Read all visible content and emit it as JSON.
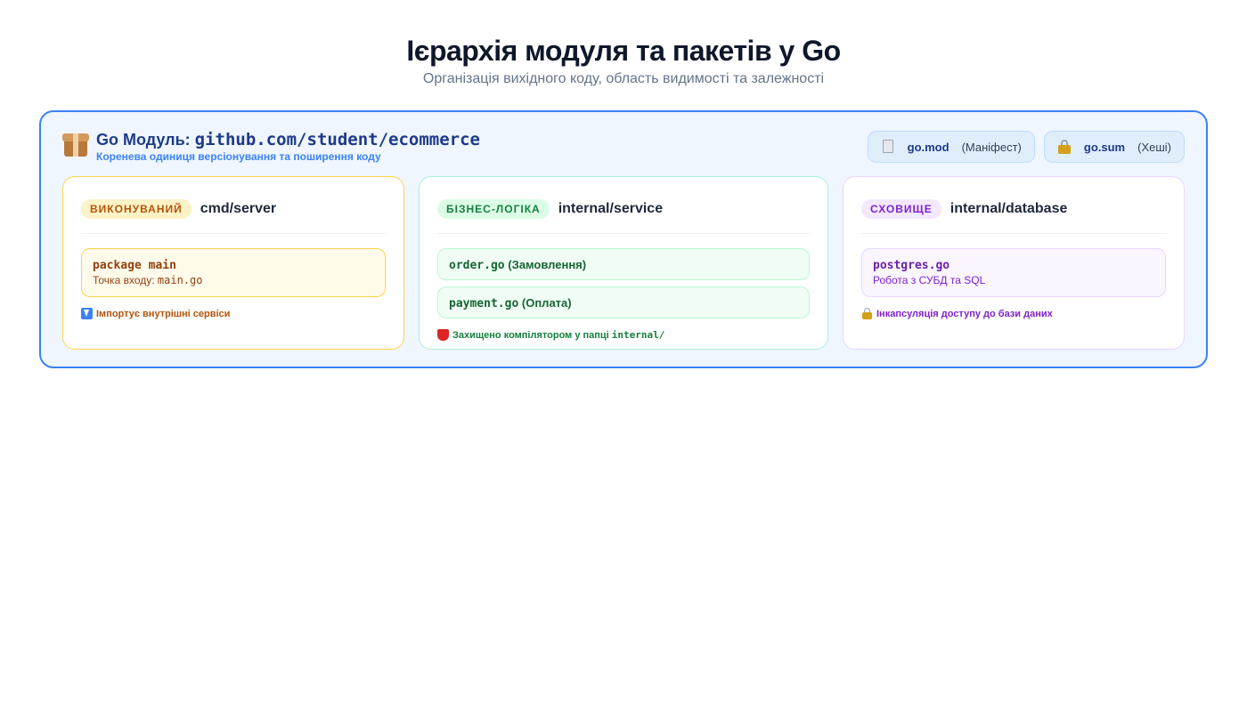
{
  "header": {
    "title": "Ієрархія модуля та пакетів у Go",
    "subtitle": "Організація вихідного коду, область видимості та залежності"
  },
  "module": {
    "icon": "package-box-icon",
    "title_prefix": "Go Модуль: ",
    "path": "github.com/student/ecommerce",
    "subtitle": "Коренева одиниця версіонування та поширення коду",
    "files": [
      {
        "icon": "document-icon",
        "name": "go.mod",
        "note": "(Маніфест)"
      },
      {
        "icon": "lock-icon",
        "name": "go.sum",
        "note": "(Хеші)"
      }
    ]
  },
  "packages": [
    {
      "badge": "ВИКОНУВАНИЙ",
      "name": "cmd/server",
      "file": {
        "code": "package main",
        "desc_prefix": "Точка входу: ",
        "desc_code": "main.go"
      },
      "footer": {
        "icon": "down-arrow-icon",
        "text": "Імпортує внутрішні сервіси"
      },
      "accent": "#b45309"
    },
    {
      "badge": "БІЗНЕС-ЛОГІКА",
      "name": "internal/service",
      "files": [
        {
          "code": "order.go",
          "label": " (Замовлення)"
        },
        {
          "code": "payment.go",
          "label": " (Оплата)"
        }
      ],
      "footer": {
        "icon": "shield-icon",
        "text": "Захищено компілятором у папці ",
        "code": "internal/"
      },
      "accent": "#15803d"
    },
    {
      "badge": "СХОВИЩЕ",
      "name": "internal/database",
      "file": {
        "code": "postgres.go",
        "desc": "Робота з СУБД та SQL"
      },
      "footer": {
        "icon": "lock-icon",
        "text": "Інкапсуляція доступу до бази даних"
      },
      "accent": "#7e22ce"
    }
  ],
  "colors": {
    "module_border": "#3b82f6",
    "module_bg": "#eff6ff"
  }
}
